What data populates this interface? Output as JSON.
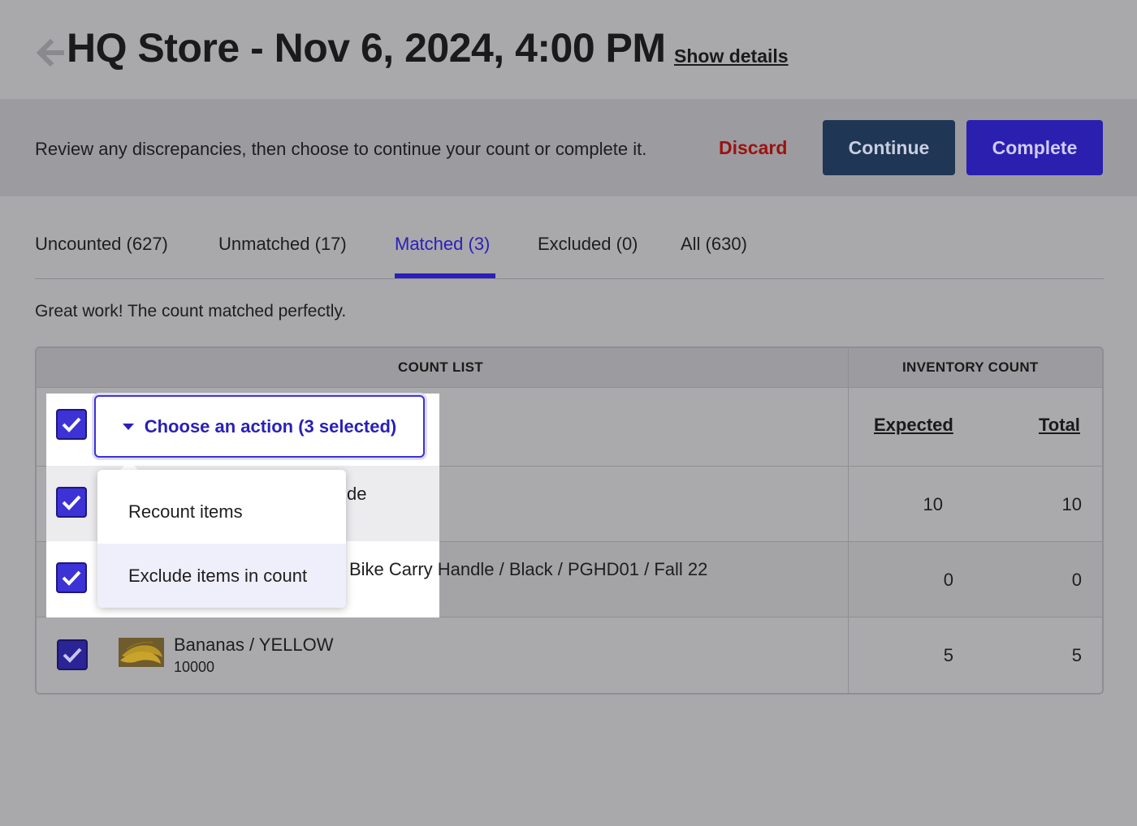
{
  "header": {
    "title": "HQ Store - Nov 6, 2024, 4:00 PM",
    "show_details": "Show details",
    "back_icon": "arrow-left-icon"
  },
  "banner": {
    "message": "Review any discrepancies, then choose to continue your count or complete it.",
    "discard": "Discard",
    "continue": "Continue",
    "complete": "Complete"
  },
  "tabs": [
    {
      "label": "Uncounted (627)"
    },
    {
      "label": "Unmatched (17)"
    },
    {
      "label": "Matched (3)",
      "active": true
    },
    {
      "label": "Excluded (0)"
    },
    {
      "label": "All (630)"
    }
  ],
  "match_message": "Great work! The count matched perfectly.",
  "table": {
    "col_count_list": "COUNT LIST",
    "col_inventory_count": "INVENTORY COUNT",
    "sub_expected": "Expected",
    "sub_total": "Total",
    "rows": [
      {
        "name_fragment": "de",
        "expected": "10",
        "total": "10"
      },
      {
        "name_fragment": "Bike Carry Handle / Black / PGHD01 / Fall 22",
        "expected": "0",
        "total": "0"
      },
      {
        "name": "Bananas / YELLOW",
        "sku": "10000",
        "expected": "5",
        "total": "5"
      }
    ]
  },
  "action_dropdown": {
    "label": "Choose an action (3 selected)",
    "menu": [
      "Recount items",
      "Exclude items in count"
    ]
  },
  "colors": {
    "accent": "#2a1fb8",
    "danger": "#9a1210",
    "continue_bg": "#1f3654"
  }
}
